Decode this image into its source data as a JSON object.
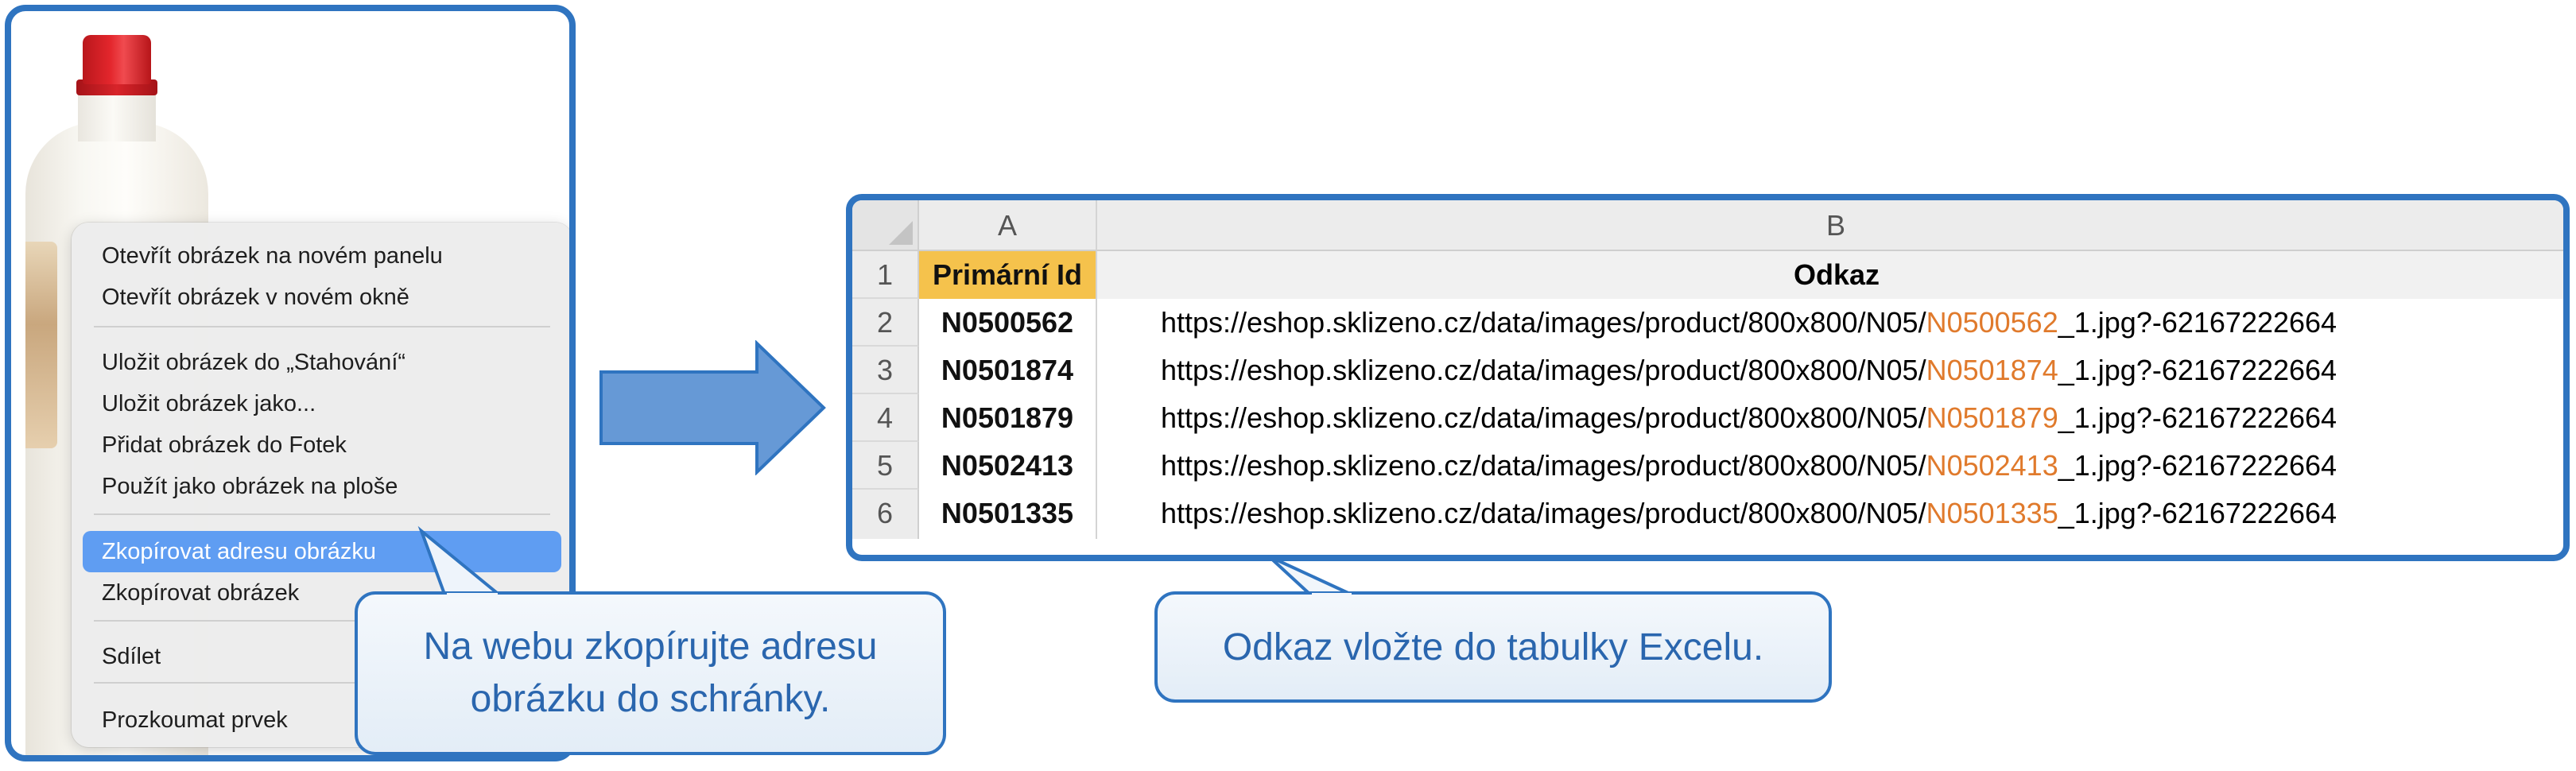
{
  "context_menu": {
    "items": [
      "Otevřít obrázek na novém panelu",
      "Otevřít obrázek v novém okně",
      "Uložit obrázek do „Stahování“",
      "Uložit obrázek jako...",
      "Přidat obrázek do Fotek",
      "Použít jako obrázek na ploše",
      "Zkopírovat adresu obrázku",
      "Zkopírovat obrázek",
      "Sdílet",
      "Prozkoumat prvek"
    ],
    "active_item": "Zkopírovat adresu obrázku"
  },
  "callouts": {
    "left": [
      "Na webu zkopírujte adresu",
      "obrázku do schránky."
    ],
    "right": "Odkaz vložte do tabulky Excelu."
  },
  "spreadsheet": {
    "column_headers": [
      "A",
      "B"
    ],
    "row_numbers": [
      "1",
      "2",
      "3",
      "4",
      "5",
      "6"
    ],
    "header_row": [
      "Primární Id",
      "Odkaz"
    ],
    "rows": [
      {
        "id": "N0500562",
        "url_prefix": "https://eshop.sklizeno.cz/data/images/product/800x800/N05/",
        "url_id": "N0500562",
        "url_suffix": "_1.jpg?-62167222664"
      },
      {
        "id": "N0501874",
        "url_prefix": "https://eshop.sklizeno.cz/data/images/product/800x800/N05/",
        "url_id": "N0501874",
        "url_suffix": "_1.jpg?-62167222664"
      },
      {
        "id": "N0501879",
        "url_prefix": "https://eshop.sklizeno.cz/data/images/product/800x800/N05/",
        "url_id": "N0501879",
        "url_suffix": "_1.jpg?-62167222664"
      },
      {
        "id": "N0502413",
        "url_prefix": "https://eshop.sklizeno.cz/data/images/product/800x800/N05/",
        "url_id": "N0502413",
        "url_suffix": "_1.jpg?-62167222664"
      },
      {
        "id": "N0501335",
        "url_prefix": "https://eshop.sklizeno.cz/data/images/product/800x800/N05/",
        "url_id": "N0501335",
        "url_suffix": "_1.jpg?-62167222664"
      }
    ],
    "header_fill_color": "#f5c24c",
    "highlight_color": "#e07a2c"
  },
  "colors": {
    "frame_border": "#2f74c0",
    "menu_highlight": "#5f9df2",
    "arrow_fill": "#6699d6"
  }
}
